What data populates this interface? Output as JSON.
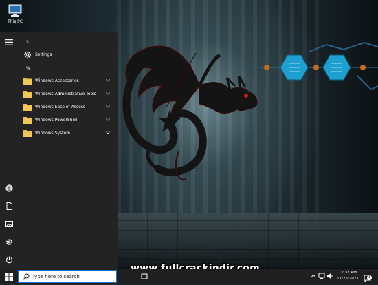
{
  "desktop": {
    "icons": [
      {
        "label": "This PC",
        "icon": "this-pc-icon"
      }
    ]
  },
  "watermark": "www.fullcrackindir.com",
  "start_menu": {
    "sections": [
      {
        "letter": "S",
        "items": [
          {
            "label": "Settings",
            "icon": "gear-icon",
            "expandable": false
          }
        ]
      },
      {
        "letter": "W",
        "items": [
          {
            "label": "Windows Accessories",
            "icon": "folder-icon",
            "expandable": true
          },
          {
            "label": "Windows Administrative Tools",
            "icon": "folder-icon",
            "expandable": true
          },
          {
            "label": "Windows Ease of Access",
            "icon": "folder-icon",
            "expandable": true
          },
          {
            "label": "Windows PowerShell",
            "icon": "folder-icon",
            "expandable": true
          },
          {
            "label": "Windows System",
            "icon": "folder-icon",
            "expandable": true
          }
        ]
      }
    ],
    "rail_icons": [
      "hamburger-menu-icon",
      "user-account-icon",
      "documents-icon",
      "pictures-icon",
      "settings-icon",
      "power-icon"
    ]
  },
  "taskbar": {
    "search_placeholder": "Type here to search",
    "clock": {
      "time": "12:32 AM",
      "date": "11/25/2021"
    },
    "notification_count": "1",
    "tray_icons": [
      "chevron-up-icon",
      "network-icon",
      "volume-icon",
      "notification-icon"
    ]
  },
  "colors": {
    "start_bg": "#232323",
    "taskbar_bg": "#1f1f1f",
    "folder": "#e8b84a",
    "hex_accent": "#1d9fd0",
    "dragon_eye": "#d2161a"
  }
}
